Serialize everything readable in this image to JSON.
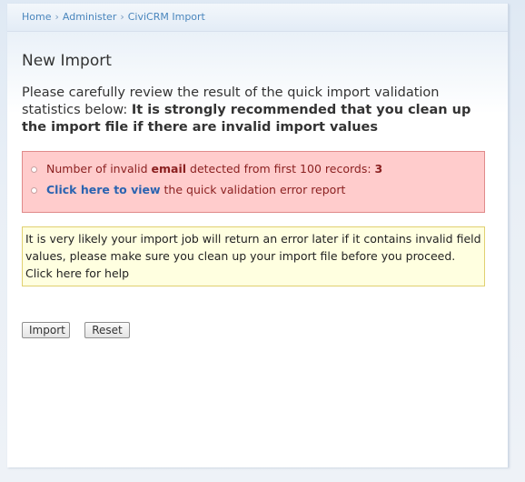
{
  "breadcrumb": {
    "items": [
      "Home",
      "Administer",
      "CiviCRM Import"
    ],
    "separator": "›"
  },
  "page": {
    "title": "New Import",
    "intro_plain": "Please carefully review the result of the quick import validation statistics below: ",
    "intro_bold": "It is strongly recommended that you clean up the import file if there are invalid import values"
  },
  "errors": {
    "item1_prefix": "Number of invalid ",
    "item1_field": "email",
    "item1_middle": " detected from first 100 records: ",
    "item1_count": "3",
    "item2_link": "Click here to view",
    "item2_suffix": " the quick validation error report"
  },
  "warning": {
    "text": "It is very likely your import job will return an error later if it contains invalid field values, please make sure you clean up your import file before you proceed.",
    "help_link": "Click here for help"
  },
  "buttons": {
    "import_label": "Import",
    "reset_label": "Reset"
  },
  "colors": {
    "link": "#4a86bd",
    "error_bg": "#ffcccc",
    "error_text": "#8a1f1f",
    "warning_bg": "#ffffe0"
  }
}
